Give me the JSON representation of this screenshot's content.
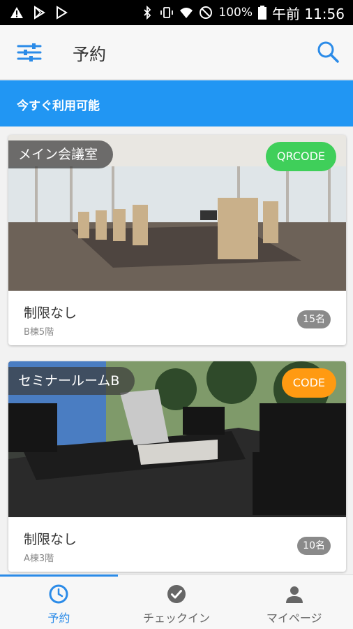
{
  "status_bar": {
    "battery": "100%",
    "time": "午前 11:56"
  },
  "app_bar": {
    "title": "予約"
  },
  "banner": {
    "text": "今すぐ利用可能"
  },
  "rooms": [
    {
      "name": "メイン会議室",
      "code_type": "QRCODE",
      "code_color": "#3fcf5a",
      "restriction": "制限なし",
      "location": "B棟5階",
      "capacity": "15名"
    },
    {
      "name": "セミナールームB",
      "code_type": "CODE",
      "code_color": "#ff9a12",
      "restriction": "制限なし",
      "location": "A棟3階",
      "capacity": "10名"
    }
  ],
  "bottom_nav": [
    {
      "label": "予約",
      "icon": "clock-icon",
      "active": true
    },
    {
      "label": "チェックイン",
      "icon": "check-circle-icon",
      "active": false
    },
    {
      "label": "マイページ",
      "icon": "person-icon",
      "active": false
    }
  ],
  "colors": {
    "accent": "#2196f3",
    "nav_active": "#2b8be8"
  }
}
